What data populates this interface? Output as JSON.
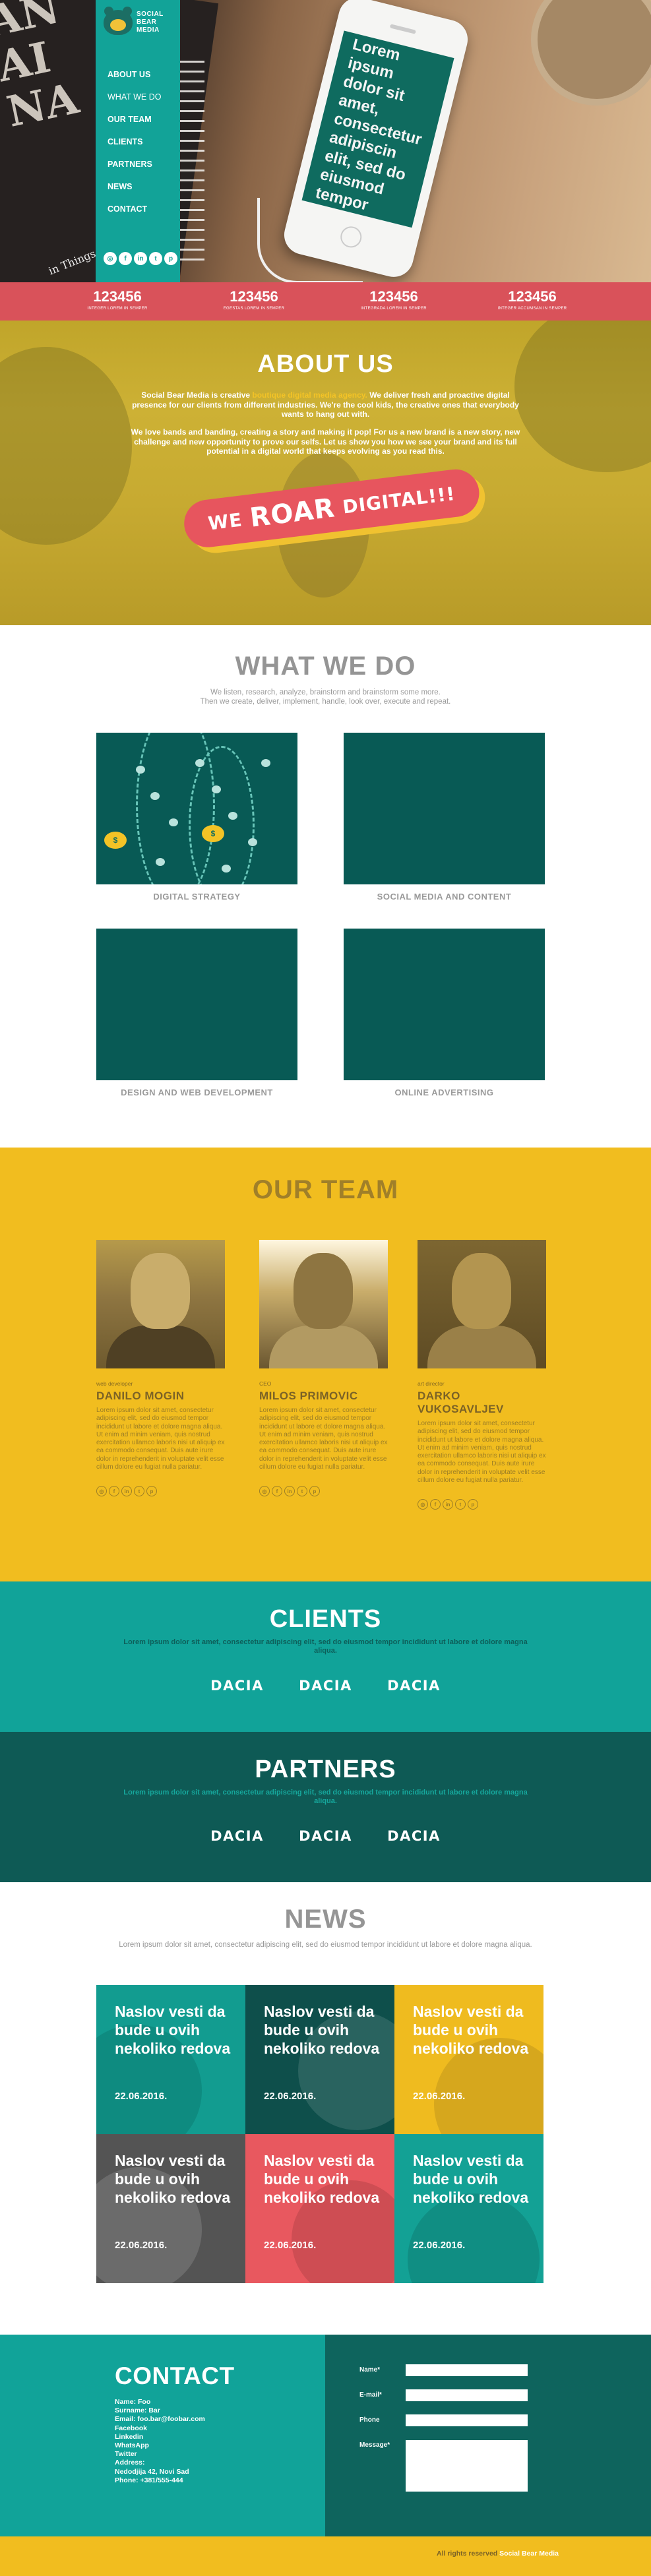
{
  "brand": {
    "logo_lines": [
      "SOCIAL",
      "BEAR",
      "MEDIA"
    ]
  },
  "nav": {
    "items": [
      "ABOUT US",
      "WHAT WE DO",
      "OUR TEAM",
      "CLIENTS",
      "PARTNERS",
      "NEWS",
      "CONTACT"
    ],
    "active": "WHAT WE DO"
  },
  "social_icons": [
    "instagram-icon",
    "facebook-icon",
    "linkedin-icon",
    "twitter-icon",
    "pinterest-icon"
  ],
  "hero": {
    "phone_text": "Lorem ipsum dolor sit amet, consectetur adipiscin elit, sed do eiusmod tempor",
    "book_text": [
      "AN",
      "AI",
      "NA"
    ],
    "note_text": "in Things pace"
  },
  "stats": [
    {
      "value": "123456",
      "label": "INTEGER LOREM IN SEMPER"
    },
    {
      "value": "123456",
      "label": "EGESTAS LOREM IN SEMPER"
    },
    {
      "value": "123456",
      "label": "INTEGRADA LOREM IN SEMPER"
    },
    {
      "value": "123456",
      "label": "INTEGER ACCUMSAN IN SEMPER"
    }
  ],
  "about": {
    "title": "ABOUT US",
    "p1_a": "Social Bear Media is creative ",
    "p1_hl": "boutique digital media agency.",
    "p1_b": " We deliver fresh and proactive digital presence for our clients from different industries. We're the cool kids, the creative ones that everybody wants to hang out with.",
    "p2": "We love bands and banding, creating a story and making it pop! For us a new brand is a new story, new challenge and new opportunity to prove our selfs. Let us show you how we see your brand and its full potential in a digital world that keeps evolving as you read this.",
    "roar": [
      "WE",
      "ROAR",
      "DIGITAL!!!"
    ]
  },
  "what": {
    "title": "WHAT WE DO",
    "sub1": "We listen, research, analyze, brainstorm and brainstorm some more.",
    "sub2": "Then we create, deliver, implement, handle, look over, execute and repeat.",
    "services": [
      "DIGITAL STRATEGY",
      "SOCIAL MEDIA AND CONTENT",
      "DESIGN AND WEB DEVELOPMENT",
      "ONLINE ADVERTISING"
    ]
  },
  "team": {
    "title": "OUR TEAM",
    "members": [
      {
        "role": "web developer",
        "name": "DANILO MOGIN"
      },
      {
        "role": "CEO",
        "name": "MILOS PRIMOVIC"
      },
      {
        "role": "art director",
        "name": "DARKO VUKOSAVLJEV"
      }
    ],
    "bio": "Lorem ipsum dolor sit amet, consectetur adipiscing elit, sed do eiusmod tempor incididunt ut labore et dolore magna aliqua. Ut enim ad minim veniam, quis nostrud exercitation ullamco laboris nisi ut aliquip ex ea commodo consequat. Duis aute irure dolor in reprehenderit in voluptate velit esse cillum dolore eu fugiat nulla pariatur."
  },
  "clients": {
    "title": "CLIENTS",
    "sub": "Lorem ipsum dolor sit amet, consectetur adipiscing elit, sed do eiusmod tempor incididunt ut labore et dolore magna aliqua.",
    "logos": [
      "DACIA",
      "DACIA",
      "DACIA"
    ]
  },
  "partners": {
    "title": "PARTNERS",
    "sub": "Lorem ipsum dolor sit amet, consectetur adipiscing elit, sed do eiusmod tempor incididunt ut labore et dolore magna aliqua.",
    "logos": [
      "DACIA",
      "DACIA",
      "DACIA"
    ]
  },
  "news": {
    "title": "NEWS",
    "sub": "Lorem ipsum dolor sit amet, consectetur adipiscing elit, sed do eiusmod tempor incididunt ut labore et dolore magna aliqua.",
    "items": [
      {
        "headline": "Naslov vesti da bude u ovih nekoliko redova",
        "date": "22.06.2016.",
        "color": "#129c90"
      },
      {
        "headline": "Naslov vesti da bude u ovih nekoliko redova",
        "date": "22.06.2016.",
        "color": "#0e4f4b"
      },
      {
        "headline": "Naslov vesti da bude u ovih nekoliko redova",
        "date": "22.06.2016.",
        "color": "#efbb1f"
      },
      {
        "headline": "Naslov vesti da bude u ovih nekoliko redova",
        "date": "22.06.2016.",
        "color": "#545454"
      },
      {
        "headline": "Naslov vesti da bude u ovih nekoliko redova",
        "date": "22.06.2016.",
        "color": "#e8585f"
      },
      {
        "headline": "Naslov vesti da bude u ovih nekoliko redova",
        "date": "22.06.2016.",
        "color": "#13a195"
      }
    ]
  },
  "contact": {
    "title": "CONTACT",
    "info": [
      "Name: Foo",
      "Surname: Bar",
      "Email: foo.bar@foobar.com",
      "Facebook",
      "Linkedin",
      "WhatsApp",
      "Twitter",
      "Address:",
      "Nedodjija 42, Novi Sad",
      "Phone: +381/555-444"
    ],
    "form": {
      "name_label": "Name*",
      "email_label": "E-mail*",
      "phone_label": "Phone",
      "message_label": "Message*"
    }
  },
  "footer": {
    "text": "All rights reserved ",
    "brand": "Social Bear Media"
  },
  "colors": {
    "teal": "#11a399",
    "dark_teal": "#0e5a55",
    "yellow": "#f1bd1f",
    "coral": "#d9525a"
  }
}
